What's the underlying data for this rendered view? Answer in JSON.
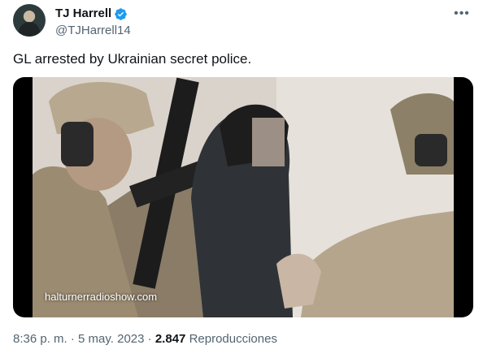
{
  "author": {
    "display_name": "TJ Harrell",
    "handle": "@TJHarrell14",
    "verified_color": "#1d9bf0"
  },
  "more_icon": "more-horizontal-icon",
  "tweet": {
    "text": "GL arrested by Ukrainian secret police."
  },
  "media": {
    "watermark": "halturnerradioshow.com"
  },
  "meta": {
    "time": "8:36 p. m.",
    "separator1": "·",
    "date": "5 may. 2023",
    "separator2": "·",
    "views_count": "2.847",
    "views_label": "Reproducciones"
  }
}
